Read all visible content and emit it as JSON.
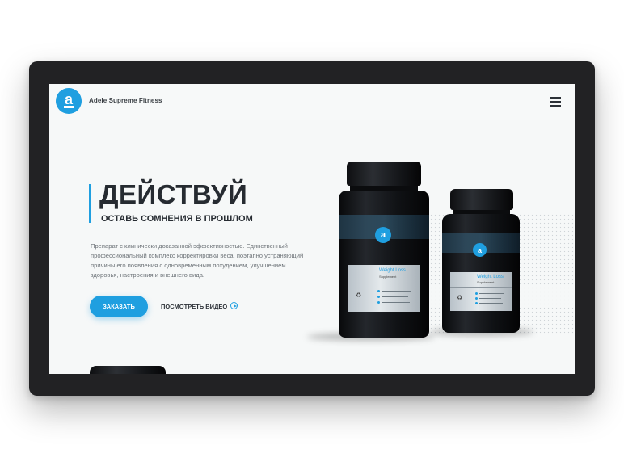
{
  "header": {
    "brand": "Adele Supreme Fitness",
    "logo_letter": "a"
  },
  "hero": {
    "title": "ДЕЙСТВУЙ",
    "subtitle": "ОСТАВЬ СОМНЕНИЯ В ПРОШЛОМ",
    "description": "Препарат с клинически доказанной эффективностью. Единственный профессиональный комплекс корректировки веса, поэтапно устраняющий причины его появления с одновременным похудением, улучшением здоровья, настроения и внешнего вида.",
    "order_button": "ЗАКАЗАТЬ",
    "video_link": "ПОСМОТРЕТЬ ВИДЕО"
  },
  "product": {
    "label_title": "Weight Loss",
    "label_sub": "Supplement",
    "logo_letter": "a"
  },
  "colors": {
    "accent": "#1f9fe0",
    "frame": "#222224",
    "screen_bg": "#f6f8f8",
    "text_dark": "#262b31"
  },
  "icons": [
    "menu-icon",
    "play-icon",
    "recycle-icon"
  ]
}
